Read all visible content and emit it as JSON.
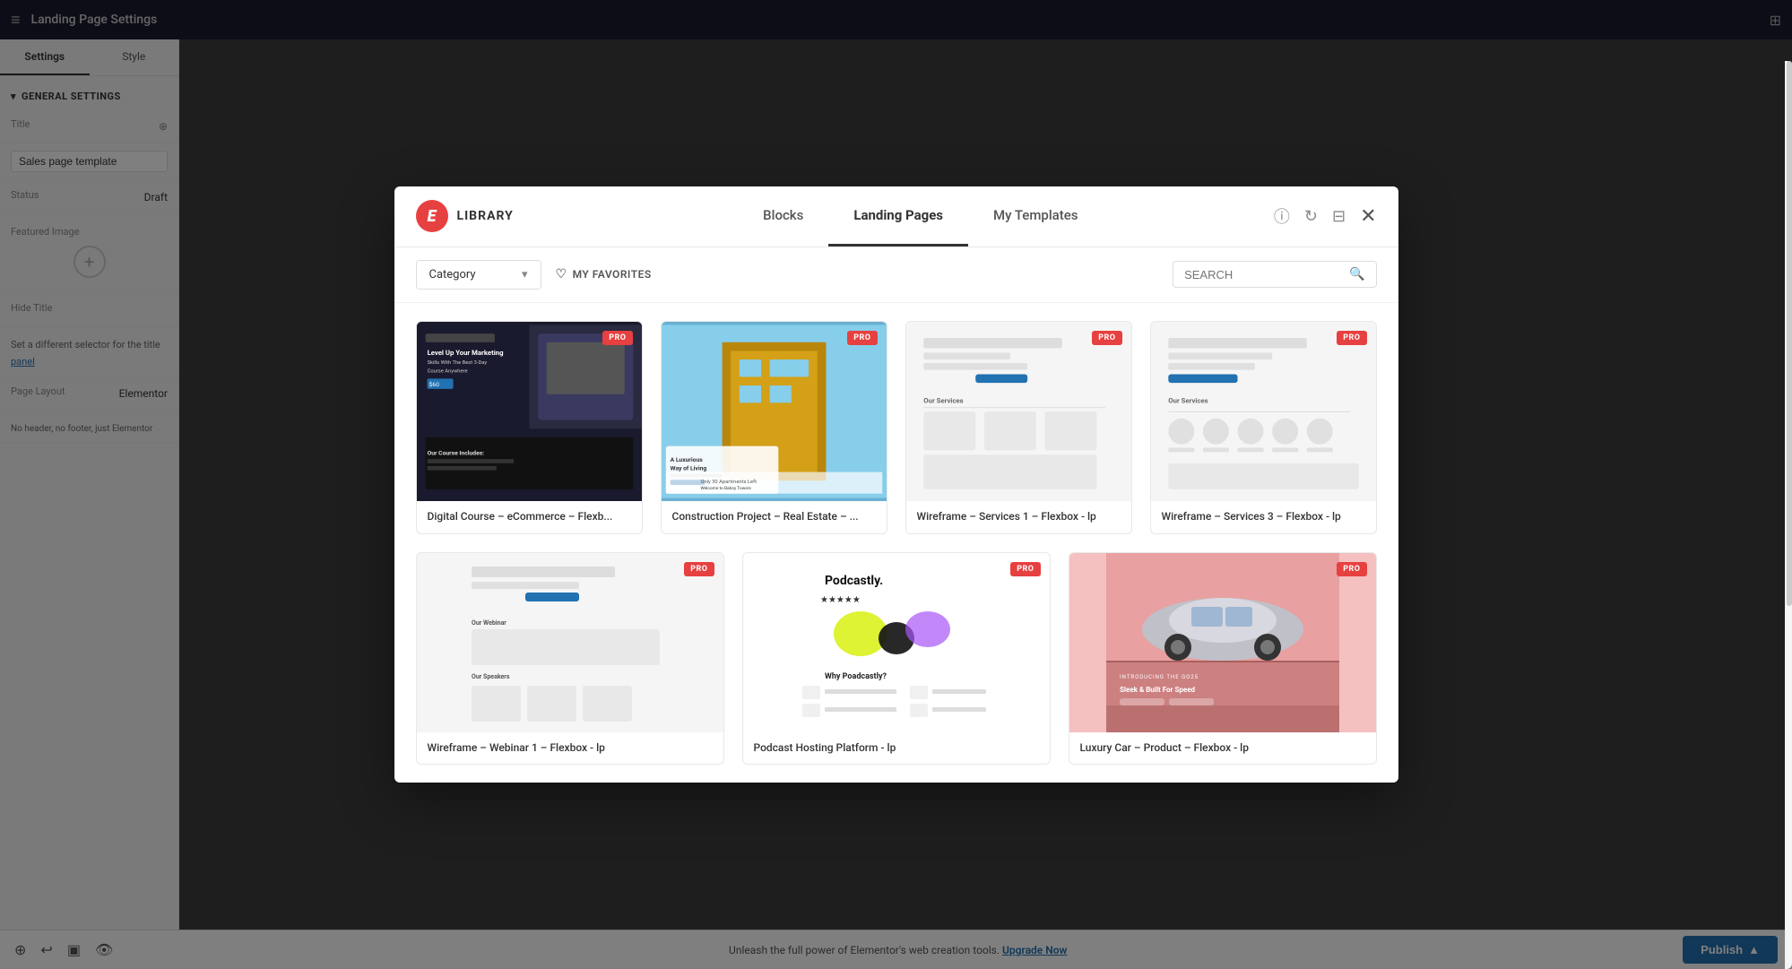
{
  "app": {
    "title": "Landing Page Settings",
    "topbar_icon": "≡",
    "grid_icon": "⊞"
  },
  "sidebar": {
    "tab_settings": "Settings",
    "tab_style": "Style",
    "section_general": "General Settings",
    "field_title_label": "Title",
    "field_title_value": "Sales page template",
    "field_status_label": "Status",
    "field_status_value": "Draft",
    "field_featured_image_label": "Featured Image",
    "field_hide_title_label": "Hide Title",
    "field_selector_note": "Set a different selector for the title",
    "selector_link": "panel",
    "field_page_layout_label": "Page Layout",
    "field_page_layout_value": "Elementor",
    "field_page_layout_note": "No header, no footer, just Elementor"
  },
  "bottom_bar": {
    "upgrade_text": "Unleash the full power of Elementor's web creation tools.",
    "upgrade_link": "Upgrade Now",
    "publish_label": "Publish",
    "publish_arrow": "▲"
  },
  "library": {
    "logo_letter": "E",
    "title": "LIBRARY",
    "tabs": [
      {
        "id": "blocks",
        "label": "Blocks",
        "active": false
      },
      {
        "id": "landing-pages",
        "label": "Landing Pages",
        "active": true
      },
      {
        "id": "my-templates",
        "label": "My Templates",
        "active": false
      }
    ],
    "toolbar": {
      "category_label": "Category",
      "favorites_label": "MY FAVORITES",
      "search_placeholder": "SEARCH"
    },
    "header_icons": {
      "info": "ⓘ",
      "refresh": "↻",
      "save": "⊟",
      "close": "✕"
    },
    "templates_row1": [
      {
        "id": "digital-course",
        "label": "Digital Course – eCommerce – Flexb...",
        "pro": true,
        "thumb_type": "dark",
        "bg": "#1a1a2e"
      },
      {
        "id": "construction-project",
        "label": "Construction Project – Real Estate – ...",
        "pro": true,
        "thumb_type": "blue",
        "bg": "#6ab0d4"
      },
      {
        "id": "wireframe-services1",
        "label": "Wireframe – Services 1 – Flexbox - lp",
        "pro": true,
        "thumb_type": "wireframe",
        "bg": "#f0f0f0"
      },
      {
        "id": "wireframe-services3",
        "label": "Wireframe – Services 3 – Flexbox - lp",
        "pro": true,
        "thumb_type": "wireframe",
        "bg": "#f0f0f0"
      }
    ],
    "templates_row2": [
      {
        "id": "wireframe-webinar1",
        "label": "Wireframe – Webinar 1 – Flexbox - lp",
        "pro": true,
        "thumb_type": "wireframe",
        "bg": "#f0f0f0"
      },
      {
        "id": "podcast-platform",
        "label": "Podcast Hosting Platform - lp",
        "pro": true,
        "thumb_type": "podcast",
        "bg": "#ffffff"
      },
      {
        "id": "luxury-car",
        "label": "Luxury Car – Product – Flexbox - lp",
        "pro": true,
        "thumb_type": "luxury",
        "bg": "#f5c5c5"
      }
    ]
  }
}
